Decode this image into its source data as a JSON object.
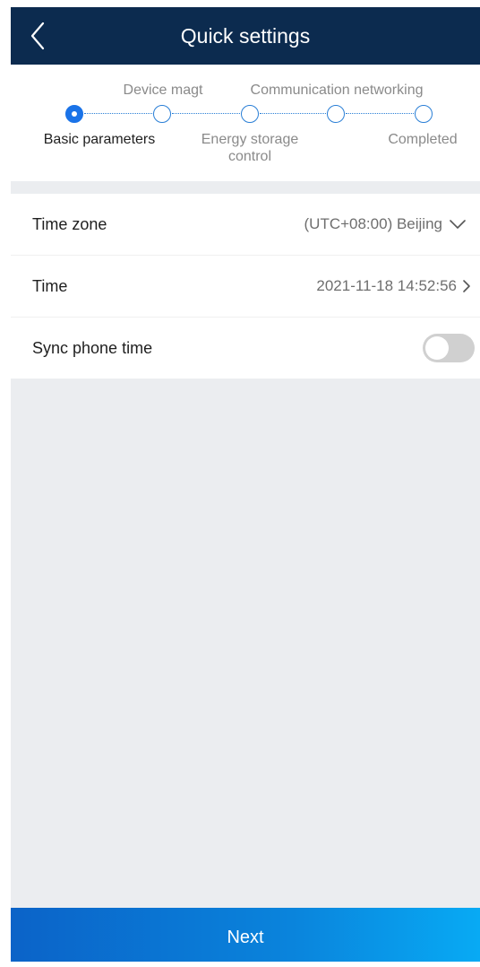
{
  "header": {
    "title": "Quick settings",
    "back_icon": "chevron-left-icon"
  },
  "steps": {
    "current_index": 0,
    "items": [
      {
        "label": "Basic parameters"
      },
      {
        "label": "Device magt"
      },
      {
        "label": "Energy storage",
        "label2": "control"
      },
      {
        "label": "Communication networking"
      },
      {
        "label": "Completed"
      }
    ]
  },
  "settings": {
    "time_zone": {
      "label": "Time zone",
      "value": "(UTC+08:00) Beijing"
    },
    "time": {
      "label": "Time",
      "value": "2021-11-18 14:52:56"
    },
    "sync_phone_time": {
      "label": "Sync phone time",
      "enabled": false
    }
  },
  "footer": {
    "next_label": "Next"
  },
  "colors": {
    "header": "#0c2b4f",
    "accent": "#1a73e8",
    "background": "#ebedf0"
  }
}
